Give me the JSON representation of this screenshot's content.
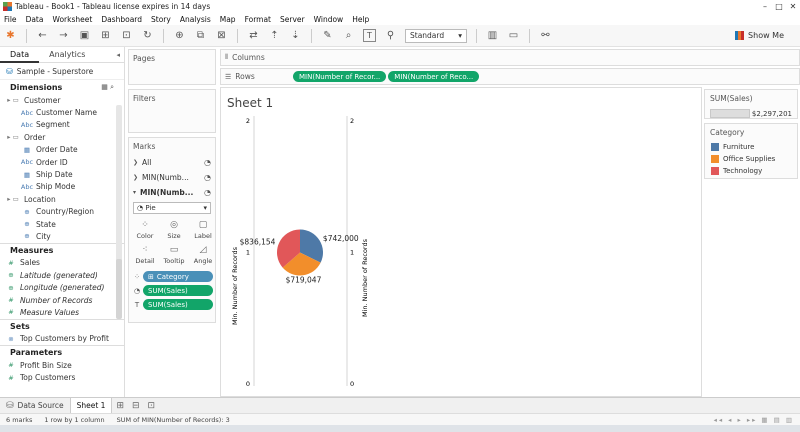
{
  "window": {
    "title": "Tableau - Book1 - Tableau license expires in 14 days",
    "controls": [
      "–",
      "□",
      "✕"
    ]
  },
  "menu": [
    "File",
    "Data",
    "Worksheet",
    "Dashboard",
    "Story",
    "Analysis",
    "Map",
    "Format",
    "Server",
    "Window",
    "Help"
  ],
  "toolbar": {
    "fit_select": "Standard",
    "show_me": "Show Me"
  },
  "data_pane": {
    "tabs": [
      "Data",
      "Analytics"
    ],
    "source": "Sample - Superstore",
    "dimensions_header": "Dimensions",
    "dimensions": [
      {
        "label": "Customer",
        "type": "folder",
        "level": 0
      },
      {
        "label": "Customer Name",
        "type": "Abc",
        "level": 1
      },
      {
        "label": "Segment",
        "type": "Abc",
        "level": 1
      },
      {
        "label": "Order",
        "type": "folder",
        "level": 0
      },
      {
        "label": "Order Date",
        "type": "date",
        "level": 1
      },
      {
        "label": "Order ID",
        "type": "Abc",
        "level": 1
      },
      {
        "label": "Ship Date",
        "type": "date",
        "level": 1
      },
      {
        "label": "Ship Mode",
        "type": "Abc",
        "level": 1
      },
      {
        "label": "Location",
        "type": "folder",
        "level": 0
      },
      {
        "label": "Country/Region",
        "type": "geo",
        "level": 1
      },
      {
        "label": "State",
        "type": "geo",
        "level": 1
      },
      {
        "label": "City",
        "type": "geo",
        "level": 1
      }
    ],
    "measures_header": "Measures",
    "measures": [
      {
        "label": "Sales",
        "italic": false
      },
      {
        "label": "Latitude (generated)",
        "italic": true
      },
      {
        "label": "Longitude (generated)",
        "italic": true
      },
      {
        "label": "Number of Records",
        "italic": true
      },
      {
        "label": "Measure Values",
        "italic": true
      }
    ],
    "sets_header": "Sets",
    "sets": [
      "Top Customers by Profit"
    ],
    "parameters_header": "Parameters",
    "parameters": [
      "Profit Bin Size",
      "Top Customers"
    ]
  },
  "cards": {
    "pages": "Pages",
    "filters": "Filters",
    "marks": "Marks",
    "marks_all": "All",
    "marks_sub1": "MIN(Numb...",
    "marks_sub2": "MIN(Numb...",
    "mark_type": "Pie",
    "encodings": [
      "Color",
      "Size",
      "Label",
      "Detail",
      "Tooltip",
      "Angle"
    ],
    "pills": [
      {
        "label": "Category",
        "color": "blue"
      },
      {
        "label": "SUM(Sales)",
        "color": "green"
      },
      {
        "label": "SUM(Sales)",
        "color": "green"
      }
    ]
  },
  "shelves": {
    "columns_label": "Columns",
    "rows_label": "Rows",
    "rows_pills": [
      "MIN(Number of Recor...",
      "MIN(Number of Reco..."
    ]
  },
  "sheet": {
    "title": "Sheet 1"
  },
  "chart_data": {
    "type": "pie",
    "title": "Sheet 1",
    "ylabel": "Min. Number of Records",
    "ylabel_right": "Min. Number of Records",
    "y_ticks": [
      "2",
      "1",
      "0"
    ],
    "ylim": [
      0,
      2
    ],
    "slices": [
      {
        "name": "Furniture",
        "value": 742000,
        "label": "$742,000",
        "color": "#4e79a7"
      },
      {
        "name": "Office Supplies",
        "value": 719047,
        "label": "$719,047",
        "color": "#f28e2b"
      },
      {
        "name": "Technology",
        "value": 836154,
        "label": "$836,154",
        "color": "#e15759"
      }
    ]
  },
  "legends": {
    "size_title": "SUM(Sales)",
    "size_value": "$2,297,201",
    "color_title": "Category",
    "items": [
      {
        "label": "Furniture",
        "color": "#4e79a7"
      },
      {
        "label": "Office Supplies",
        "color": "#f28e2b"
      },
      {
        "label": "Technology",
        "color": "#e15759"
      }
    ]
  },
  "tabs": {
    "data_source": "Data Source",
    "sheet": "Sheet 1"
  },
  "status": {
    "marks": "6 marks",
    "rows_cols": "1 row by 1 column",
    "sum": "SUM of MIN(Number of Records): 3"
  }
}
